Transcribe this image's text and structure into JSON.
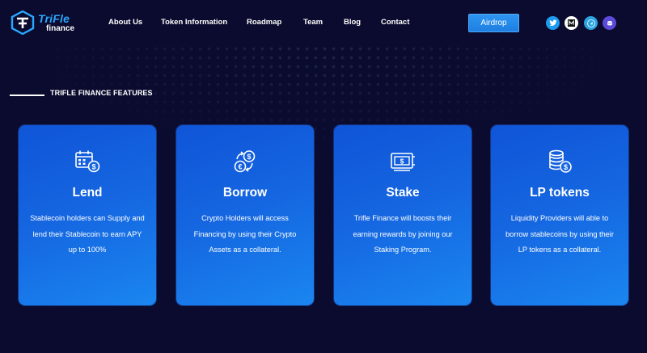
{
  "brand": {
    "line1": "TriFle",
    "line2": "finance"
  },
  "nav": {
    "items": [
      {
        "label": "About Us"
      },
      {
        "label": "Token Information"
      },
      {
        "label": "Roadmap"
      },
      {
        "label": "Team"
      },
      {
        "label": "Blog"
      },
      {
        "label": "Contact"
      }
    ],
    "airdrop_label": "Airdrop",
    "socials": [
      {
        "icon": "twitter-icon",
        "color": "#1d9bf0"
      },
      {
        "icon": "medium-icon",
        "color": "#ffffff"
      },
      {
        "icon": "telegram-icon",
        "color": "#2aa3e0"
      },
      {
        "icon": "discord-icon",
        "color": "#5b4bd8"
      }
    ]
  },
  "section": {
    "heading": "TRIFLE FINANCE FEATURES"
  },
  "cards": [
    {
      "icon": "calendar-dollar-icon",
      "title": "Lend",
      "description": "Stablecoin  holders can Supply and lend their Stablecoin to earn APY up to 100%"
    },
    {
      "icon": "currency-exchange-icon",
      "title": "Borrow",
      "description": "Crypto Holders will access Financing by using their Crypto Assets as a collateral."
    },
    {
      "icon": "cash-stake-icon",
      "title": "Stake",
      "description": "Trifle Finance will boosts their earning rewards by joining our Staking Program."
    },
    {
      "icon": "coin-stack-icon",
      "title": "LP tokens",
      "description": "Liquidity Providers will able to borrow stablecoins by using their LP tokens as a collateral."
    }
  ],
  "colors": {
    "background": "#0a0b2e",
    "card": "#1565e0",
    "accent": "#2aa7ff"
  }
}
